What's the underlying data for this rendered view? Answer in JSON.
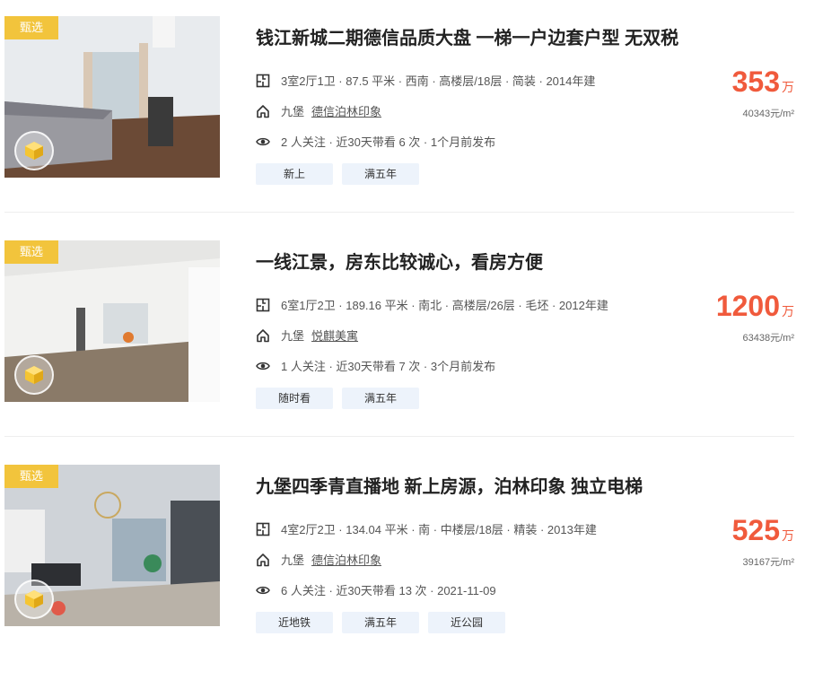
{
  "listings": [
    {
      "badge": "甄选",
      "title": "钱江新城二期德信品质大盘 一梯一户边套户型 无双税",
      "info": "3室2厅1卫 · 87.5 平米 · 西南 · 高楼层/18层 · 简装 · 2014年建",
      "area": "九堡",
      "community": "德信泊林印象",
      "follow": "2 人关注 · 近30天带看 6 次 · 1个月前发布",
      "tags": [
        "新上",
        "满五年"
      ],
      "price": "353",
      "price_unit": "万",
      "unit_price": "40343元/m²",
      "photo_colors": {
        "wall": "#e8ebee",
        "floor": "#6b4a36",
        "window": "#c7d2d8"
      }
    },
    {
      "badge": "甄选",
      "title": "一线江景，房东比较诚心，看房方便",
      "info": "6室1厅2卫 · 189.16 平米 · 南北 · 高楼层/26层 · 毛坯 · 2012年建",
      "area": "九堡",
      "community": "悦麒美寓",
      "follow": "1 人关注 · 近30天带看 7 次 · 3个月前发布",
      "tags": [
        "随时看",
        "满五年"
      ],
      "price": "1200",
      "price_unit": "万",
      "unit_price": "63438元/m²",
      "photo_colors": {
        "wall": "#f2f2f0",
        "floor": "#8a7a68",
        "window": "#d8dde0"
      }
    },
    {
      "badge": "甄选",
      "title": "九堡四季青直播地 新上房源，泊林印象 独立电梯",
      "info": "4室2厅2卫 · 134.04 平米 · 南 · 中楼层/18层 · 精装 · 2013年建",
      "area": "九堡",
      "community": "德信泊林印象",
      "follow": "6 人关注 · 近30天带看 13 次 · 2021-11-09",
      "tags": [
        "近地铁",
        "满五年",
        "近公园"
      ],
      "price": "525",
      "price_unit": "万",
      "unit_price": "39167元/m²",
      "photo_colors": {
        "wall": "#cfd3d8",
        "floor": "#b9b2a8",
        "window": "#9fb0bd"
      }
    }
  ],
  "icons": {
    "floorplan": "floorplan-icon",
    "home": "home-icon",
    "eye": "eye-icon",
    "vr": "vr-cube-icon"
  }
}
